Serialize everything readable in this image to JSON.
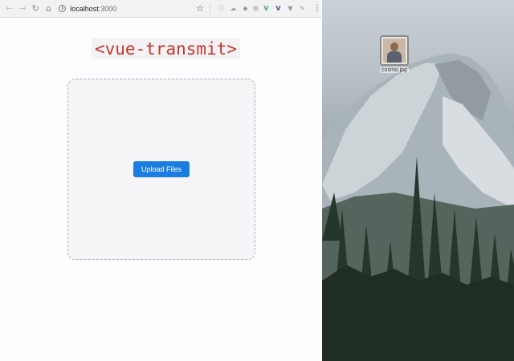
{
  "browser": {
    "toolbar": {
      "nav_icons": [
        "back-icon",
        "forward-icon",
        "reload-icon",
        "home-icon"
      ],
      "url_host": "localhost",
      "url_port": ":3000",
      "extension_icons": [
        "info-icon",
        "cloud-icon",
        "dropbox-icon",
        "vue-devtools-icon",
        "vuex-icon",
        "vue-icon",
        "extension-icon",
        "pencil-icon"
      ]
    },
    "page": {
      "title": "<vue-transmit>",
      "dropzone": {
        "upload_button_label": "Upload Files"
      }
    }
  },
  "desktop": {
    "file": {
      "name": "cosmo.jpg"
    }
  },
  "colors": {
    "title_text": "#c0392b",
    "button_bg": "#1a7ee0",
    "dropzone_border": "#b0b0b8"
  }
}
